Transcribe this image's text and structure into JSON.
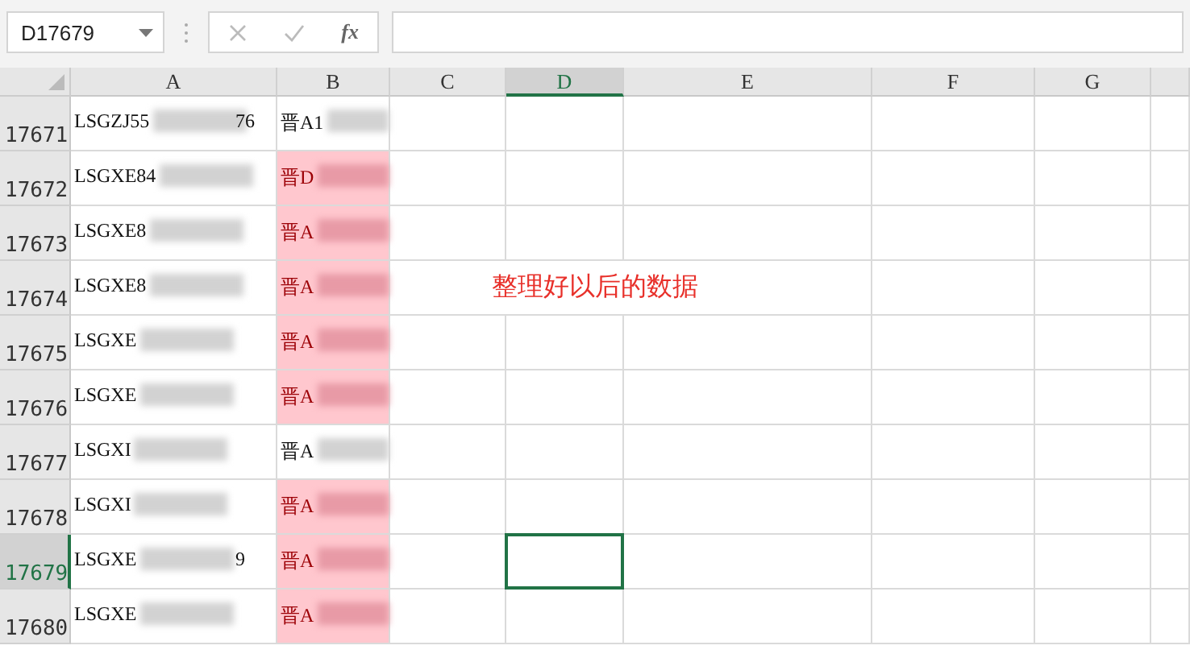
{
  "name_box": {
    "value": "D17679"
  },
  "formula_bar": {
    "fx_label": "fx"
  },
  "columns": [
    {
      "label": "A",
      "selected": false
    },
    {
      "label": "B",
      "selected": false
    },
    {
      "label": "C",
      "selected": false
    },
    {
      "label": "D",
      "selected": true
    },
    {
      "label": "E",
      "selected": false
    },
    {
      "label": "F",
      "selected": false
    },
    {
      "label": "G",
      "selected": false
    }
  ],
  "rows": [
    {
      "number": "17671",
      "selected": false,
      "a": "LSGZJ55",
      "a_end": "76",
      "b": "晋A1",
      "highlighted": false
    },
    {
      "number": "17672",
      "selected": false,
      "a": "LSGXE84",
      "b": "晋D",
      "highlighted": true
    },
    {
      "number": "17673",
      "selected": false,
      "a": "LSGXE8",
      "b": "晋A",
      "highlighted": true
    },
    {
      "number": "17674",
      "selected": false,
      "a": "LSGXE8",
      "b": "晋A",
      "highlighted": true,
      "d": "整理好以后的数据"
    },
    {
      "number": "17675",
      "selected": false,
      "a": "LSGXE",
      "b": "晋A",
      "highlighted": true
    },
    {
      "number": "17676",
      "selected": false,
      "a": "LSGXE",
      "b": "晋A",
      "highlighted": true
    },
    {
      "number": "17677",
      "selected": false,
      "a": "LSGXI",
      "b": "晋A",
      "highlighted": false
    },
    {
      "number": "17678",
      "selected": false,
      "a": "LSGXI",
      "b": "晋A",
      "highlighted": true
    },
    {
      "number": "17679",
      "selected": true,
      "a": "LSGXE",
      "a_end": "9",
      "b": "晋A",
      "highlighted": true
    },
    {
      "number": "17680",
      "selected": false,
      "a": "LSGXE",
      "b": "晋A",
      "highlighted": true
    }
  ]
}
